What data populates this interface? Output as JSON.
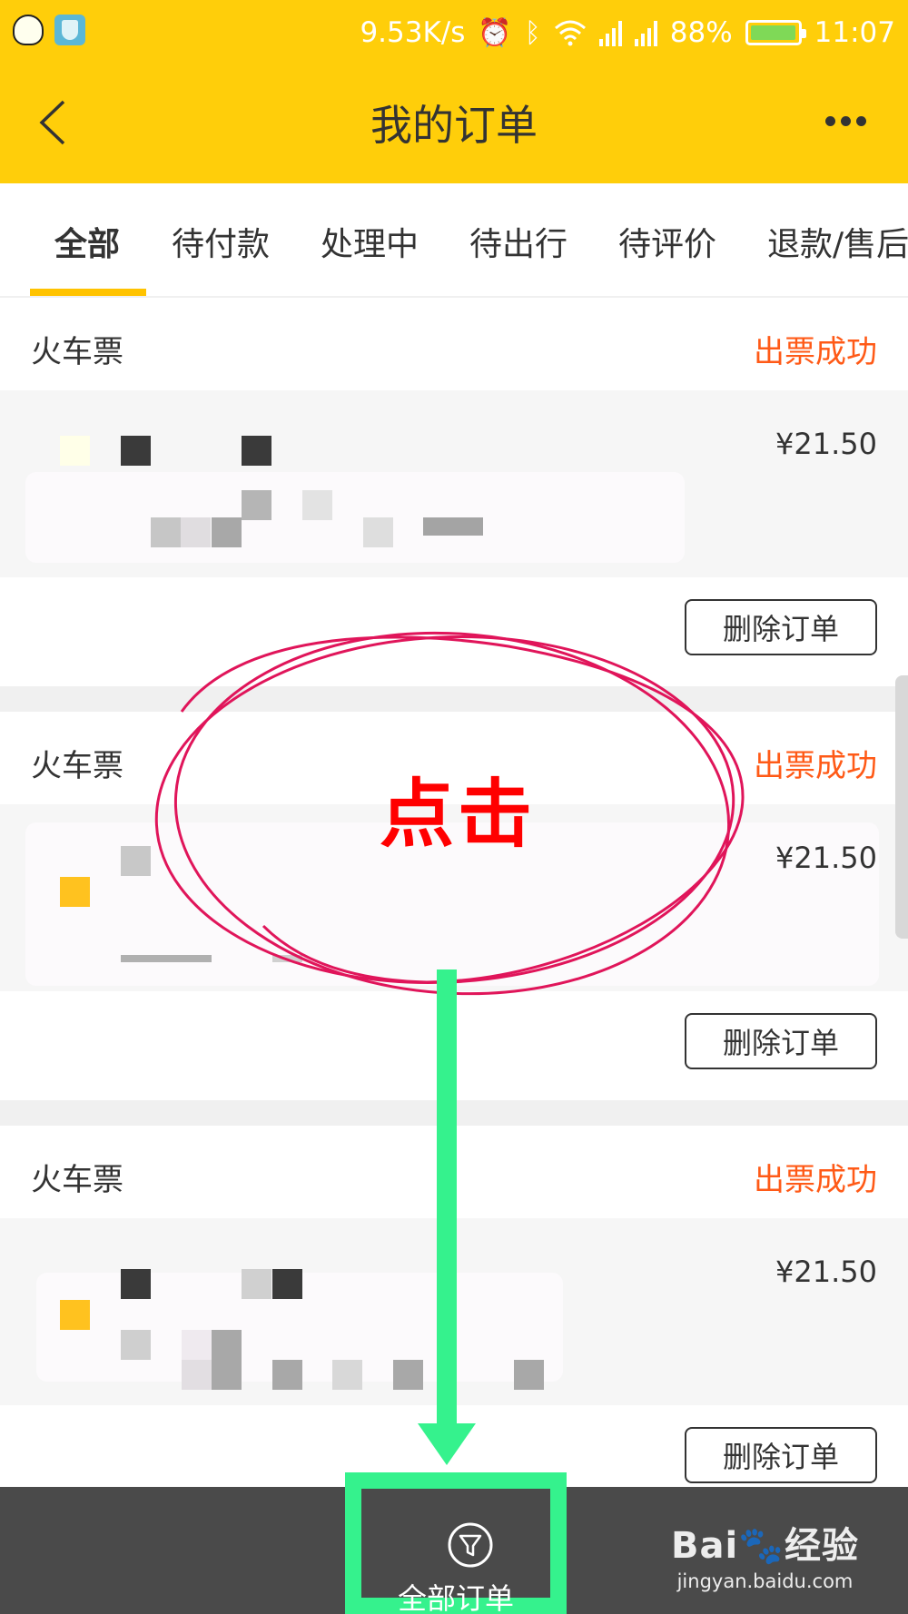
{
  "status_bar": {
    "speed": "9.53K/s",
    "battery": "88%",
    "time": "11:07",
    "icons": [
      "qq-icon",
      "shield-icon",
      "alarm-icon",
      "bluetooth-icon",
      "wifi-icon",
      "signal-icon",
      "signal-icon",
      "battery-icon"
    ]
  },
  "header": {
    "title": "我的订单",
    "back_icon": "chevron-left-icon",
    "more_icon": "more-icon",
    "background": "#ffce0a"
  },
  "tabs": [
    {
      "label": "全部",
      "active": true
    },
    {
      "label": "待付款",
      "active": false
    },
    {
      "label": "处理中",
      "active": false
    },
    {
      "label": "待出行",
      "active": false
    },
    {
      "label": "待评价",
      "active": false
    },
    {
      "label": "退款/售后",
      "active": false
    }
  ],
  "orders": [
    {
      "type": "火车票",
      "status": "出票成功",
      "price": "¥21.50",
      "delete_label": "删除订单"
    },
    {
      "type": "火车票",
      "status": "出票成功",
      "price": "¥21.50",
      "delete_label": "删除订单"
    },
    {
      "type": "火车票",
      "status": "出票成功",
      "price": "¥21.50",
      "delete_label": "删除订单"
    }
  ],
  "bottom_bar": {
    "filter_label": "全部订单",
    "filter_icon": "filter-icon"
  },
  "annotation": {
    "text": "点击",
    "circle_color": "#e0155a",
    "arrow_color": "#35f28d"
  },
  "watermark": {
    "logo": "Baiᴜ经验",
    "url": "jingyan.baidu.com"
  },
  "colors": {
    "accent": "#ffc300",
    "status_success": "#ff5a17"
  }
}
